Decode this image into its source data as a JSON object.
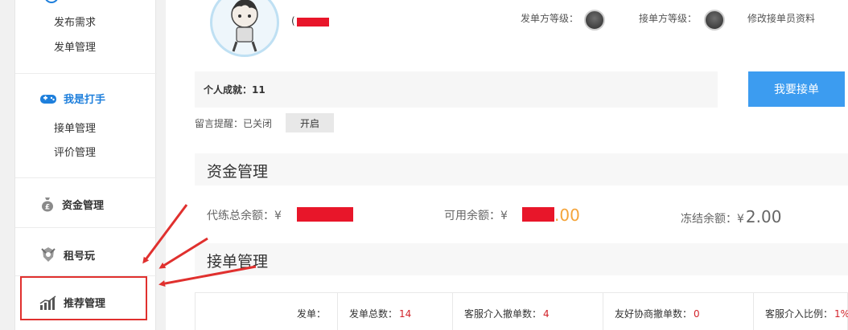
{
  "sidebar": {
    "publish": {
      "items": [
        {
          "label": "发布需求"
        },
        {
          "label": "发单管理"
        }
      ]
    },
    "player": {
      "title": "我是打手",
      "items": [
        {
          "label": "接单管理"
        },
        {
          "label": "评价管理"
        }
      ]
    },
    "funds": {
      "label": "资金管理"
    },
    "rent": {
      "label": "租号玩"
    },
    "recommend": {
      "label": "推荐管理"
    }
  },
  "profile": {
    "name_prefix": "(",
    "issuer_level_label": "发单方等级：",
    "taker_level_label": "接单方等级：",
    "edit_link": "修改接单员资料",
    "achievement": "个人成就：11",
    "accept_button": "我要接单",
    "reminder": "留言提醒：已关闭",
    "reminder_button": "开启"
  },
  "funds": {
    "title": "资金管理",
    "total_label": "代练总余额：¥",
    "total_value": "",
    "available_label": "可用余额：¥",
    "available_value": "",
    "frozen_label": "冻结余额：¥",
    "frozen_value": "2.00"
  },
  "orders": {
    "title": "接单管理",
    "row_label": "发单：",
    "stats": [
      {
        "label": "发单总数：",
        "value": "14"
      },
      {
        "label": "客服介入撤单数：",
        "value": "4"
      },
      {
        "label": "友好协商撤单数：",
        "value": "0"
      },
      {
        "label": "客服介入比例：",
        "value": "1%"
      }
    ]
  },
  "colors": {
    "accent_blue": "#3c9cf0",
    "sidebar_active": "#1e7fdc",
    "highlight_red": "#e0302e",
    "number_red": "#d2232a",
    "available_orange": "#f4a43a",
    "total_blue": "#2b6fd6"
  }
}
